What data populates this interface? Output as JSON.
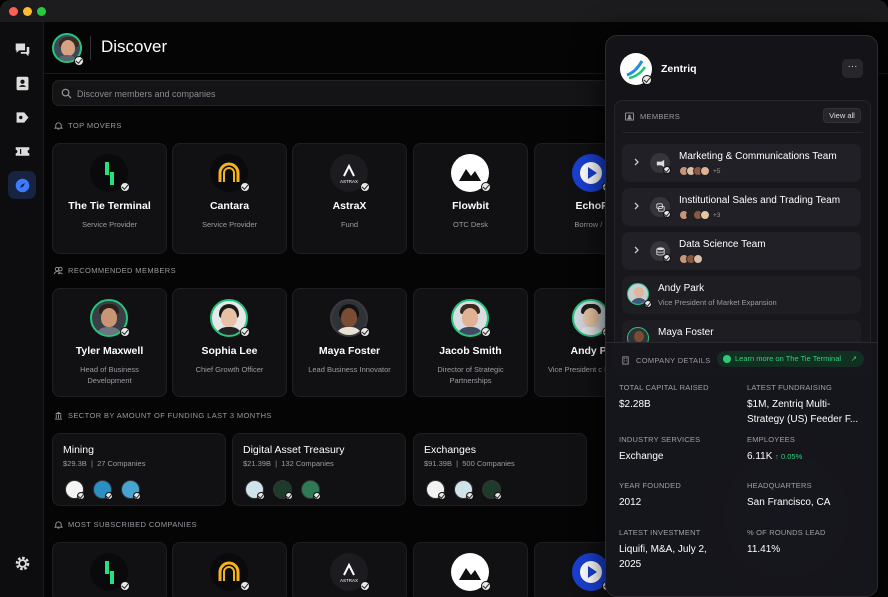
{
  "header": {
    "title": "Discover"
  },
  "search": {
    "placeholder": "Discover members and companies"
  },
  "sections": {
    "top_movers": "TOP MOVERS",
    "recommended": "RECOMMENDED MEMBERS",
    "sector": "SECTOR BY AMOUNT OF FUNDING LAST 3 MONTHS",
    "most_subscribed": "MOST SUBSCRIBED COMPANIES"
  },
  "top_movers": [
    {
      "name": "The Tie Terminal",
      "sub": "Service Provider"
    },
    {
      "name": "Cantara",
      "sub": "Service Provider"
    },
    {
      "name": "AstraX",
      "sub": "Fund"
    },
    {
      "name": "Flowbit",
      "sub": "OTC Desk"
    },
    {
      "name": "EchoF",
      "sub": "Borrow / L"
    }
  ],
  "astrax_logo_text": "ASTRAX",
  "recommended_members": [
    {
      "name": "Tyler Maxwell",
      "title": "Head of Business Development"
    },
    {
      "name": "Sophia Lee",
      "title": "Chief Growth Officer"
    },
    {
      "name": "Maya Foster",
      "title": "Lead Business Innovator"
    },
    {
      "name": "Jacob Smith",
      "title": "Director of Strategic Partnerships"
    },
    {
      "name": "Andy Pa",
      "title": "Vice President c Expansio"
    }
  ],
  "sectors": [
    {
      "name": "Mining",
      "amount": "$29.3B",
      "count": "27 Companies"
    },
    {
      "name": "Digital Asset Treasury",
      "amount": "$21.39B",
      "count": "132 Companies"
    },
    {
      "name": "Exchanges",
      "amount": "$91.39B",
      "count": "500 Companies"
    }
  ],
  "panel": {
    "company": "Zentriq",
    "more_label": "···",
    "members_label": "MEMBERS",
    "view_all": "View all",
    "teams": [
      {
        "name": "Marketing & Communications Team",
        "more": "+5"
      },
      {
        "name": "Institutional Sales and Trading Team",
        "more": "+3"
      },
      {
        "name": "Data Science Team",
        "more": ""
      }
    ],
    "members": [
      {
        "name": "Andy Park",
        "title": "Vice President of Market Expansion"
      },
      {
        "name": "Maya Foster",
        "title": ""
      }
    ],
    "company_details_label": "COMPANY DETAILS",
    "learn_more": "Learn more on The Tie Terminal",
    "learn_more_arrow": "↗",
    "details": {
      "total_capital_label": "TOTAL CAPITAL RAISED",
      "total_capital": "$2.28B",
      "latest_fundraising_label": "LATEST FUNDRAISING",
      "latest_fundraising": "$1M, Zentriq Multi-Strategy (US) Feeder F...",
      "industry_label": "INDUSTRY SERVICES",
      "industry": "Exchange",
      "employees_label": "EMPLOYEES",
      "employees": "6.11K",
      "employees_change": "↑ 0.05%",
      "year_label": "YEAR FOUNDED",
      "year": "2012",
      "hq_label": "HEADQUARTERS",
      "hq": "San Francisco, CA",
      "latest_investment_label": "LATEST INVESTMENT",
      "latest_investment": "Liquifi, M&A,  July 2, 2025",
      "rounds_lead_label": "% OF ROUNDS LEAD",
      "rounds_lead": "11.41%"
    }
  },
  "colors": {
    "accent_green": "#27c47f",
    "active_nav": "#17233f",
    "learn_green": "#33d07f"
  }
}
